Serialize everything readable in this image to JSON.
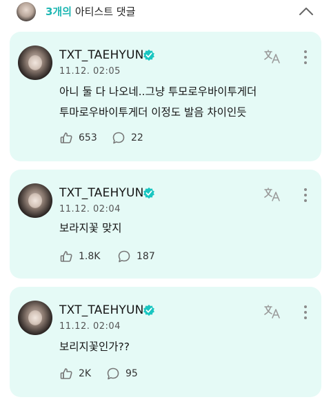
{
  "header": {
    "count": "3개의",
    "title_rest": " 아티스트 댓글"
  },
  "comments": [
    {
      "username": "TXT_TAEHYUN",
      "timestamp": "11.12. 02:05",
      "text": "아니 둘 다 나오네..그냥 투모로우바이투게더\n투마로우바이투게더 이정도 발음 차이인듯",
      "likes": "653",
      "replies": "22"
    },
    {
      "username": "TXT_TAEHYUN",
      "timestamp": "11.12. 02:04",
      "text": "보라지꽃 맞지",
      "likes": "1.8K",
      "replies": "187"
    },
    {
      "username": "TXT_TAEHYUN",
      "timestamp": "11.12. 02:04",
      "text": "보리지꽃인가??",
      "likes": "2K",
      "replies": "95"
    }
  ],
  "colors": {
    "card_bg": "#e5faf6",
    "accent": "#1fb7b3",
    "verified": "#19c6c1"
  },
  "icons": [
    "collapse-chevron-icon",
    "verified-badge-icon",
    "translate-icon",
    "more-options-icon",
    "like-icon",
    "reply-icon"
  ]
}
